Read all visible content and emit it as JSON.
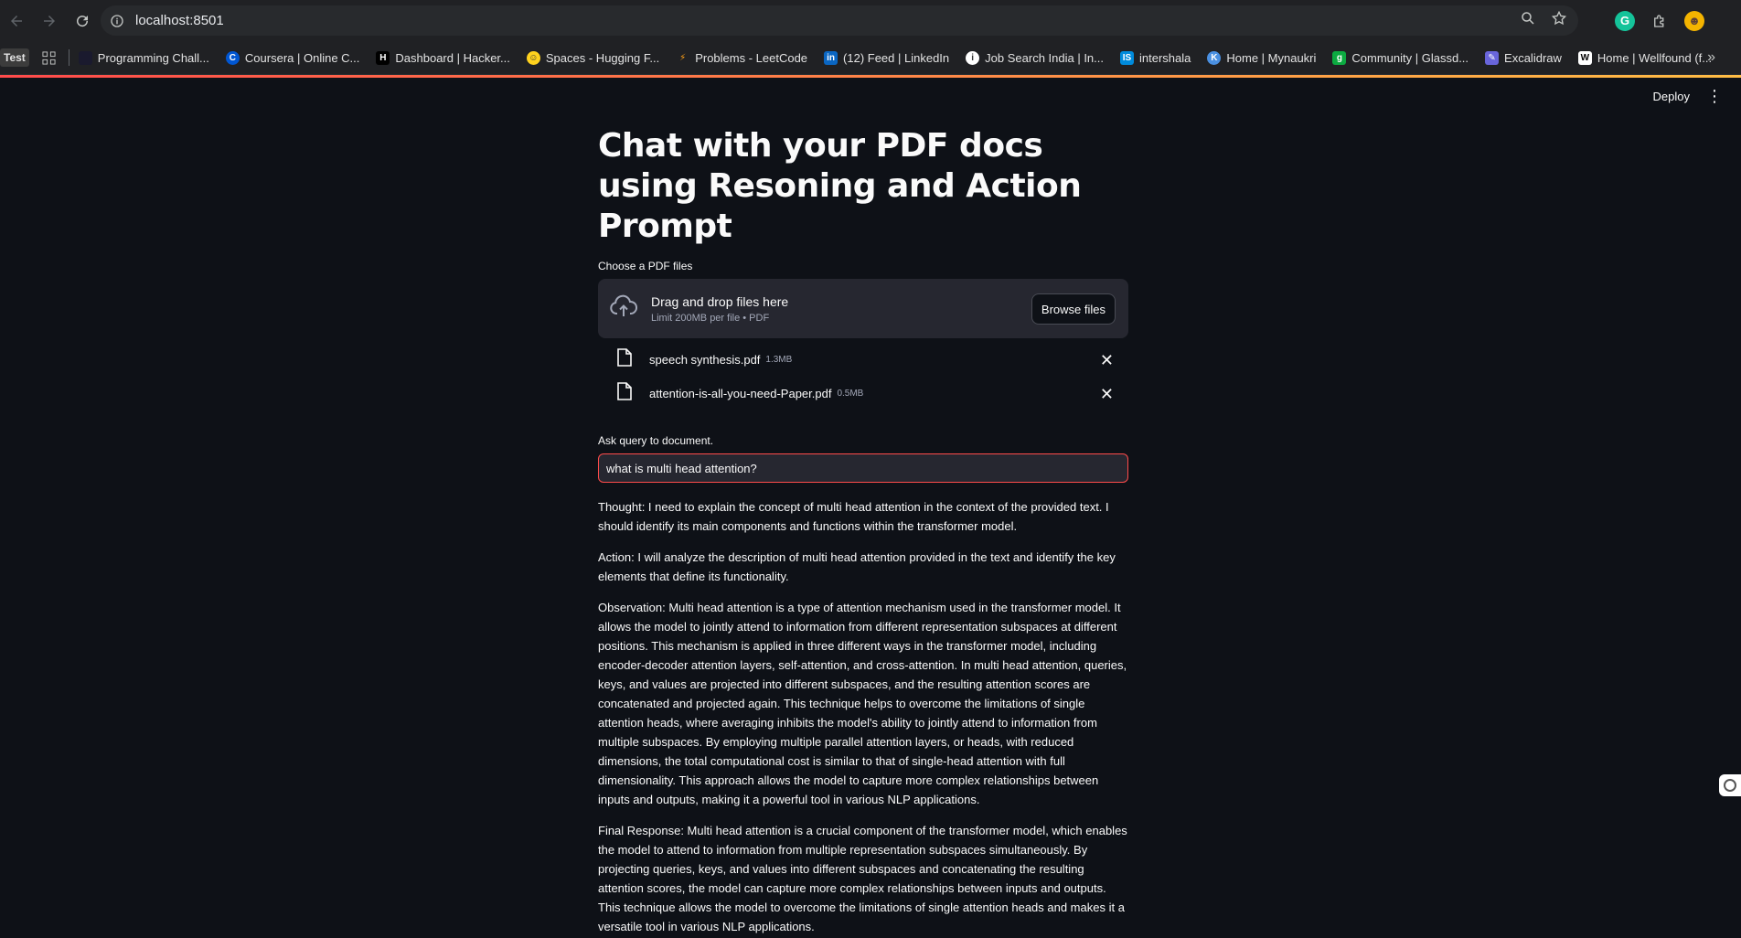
{
  "browser": {
    "url": "localhost:8501",
    "bookmarks": [
      {
        "label": "Test"
      },
      {
        "label": "Programming Chall...",
        "icon": "bookmark-favicon",
        "color": "#1a1a2e"
      },
      {
        "label": "Coursera | Online C...",
        "icon": "coursera-icon",
        "color": "#0056d2"
      },
      {
        "label": "Dashboard | Hacker...",
        "icon": "hackerrank-icon",
        "color": "#000000"
      },
      {
        "label": "Spaces - Hugging F...",
        "icon": "huggingface-icon",
        "color": "#ffd21e"
      },
      {
        "label": "Problems - LeetCode",
        "icon": "leetcode-icon",
        "color": "#ffa116"
      },
      {
        "label": "(12) Feed | LinkedIn",
        "icon": "linkedin-icon",
        "color": "#0a66c2"
      },
      {
        "label": "Job Search India | In...",
        "icon": "indeed-icon",
        "color": "#ffffff"
      },
      {
        "label": "intershala",
        "icon": "internshala-icon",
        "color": "#008bdc"
      },
      {
        "label": "Home | Mynaukri",
        "icon": "naukri-icon",
        "color": "#4a90e2"
      },
      {
        "label": "Community | Glassd...",
        "icon": "glassdoor-icon",
        "color": "#0caa41"
      },
      {
        "label": "Excalidraw",
        "icon": "excalidraw-icon",
        "color": "#6965db"
      },
      {
        "label": "Home | Wellfound (f...",
        "icon": "wellfound-icon",
        "color": "#ffffff"
      }
    ]
  },
  "app": {
    "deploy_label": "Deploy",
    "title": "Chat with your PDF docs using Resoning and Action Prompt",
    "uploader": {
      "label": "Choose a PDF files",
      "drop_text": "Drag and drop files here",
      "limit_text": "Limit 200MB per file • PDF",
      "browse_label": "Browse files"
    },
    "files": [
      {
        "name": "speech synthesis.pdf",
        "size": "1.3MB"
      },
      {
        "name": "attention-is-all-you-need-Paper.pdf",
        "size": "0.5MB"
      }
    ],
    "query": {
      "label": "Ask query to document.",
      "value": "what is multi head attention?"
    },
    "response": {
      "thought": "Thought: I need to explain the concept of multi head attention in the context of the provided text. I should identify its main components and functions within the transformer model.",
      "action": "Action: I will analyze the description of multi head attention provided in the text and identify the key elements that define its functionality.",
      "observation": "Observation: Multi head attention is a type of attention mechanism used in the transformer model. It allows the model to jointly attend to information from different representation subspaces at different positions. This mechanism is applied in three different ways in the transformer model, including encoder-decoder attention layers, self-attention, and cross-attention. In multi head attention, queries, keys, and values are projected into different subspaces, and the resulting attention scores are concatenated and projected again. This technique helps to overcome the limitations of single attention heads, where averaging inhibits the model's ability to jointly attend to information from multiple subspaces. By employing multiple parallel attention layers, or heads, with reduced dimensions, the total computational cost is similar to that of single-head attention with full dimensionality. This approach allows the model to capture more complex relationships between inputs and outputs, making it a powerful tool in various NLP applications.",
      "final": "Final Response: Multi head attention is a crucial component of the transformer model, which enables the model to attend to information from multiple representation subspaces simultaneously. By projecting queries, keys, and values into different subspaces and concatenating the resulting attention scores, the model can capture more complex relationships between inputs and outputs. This technique allows the model to overcome the limitations of single attention heads and makes it a versatile tool in various NLP applications."
    }
  },
  "colors": {
    "background": "#0e1117",
    "widget_bg": "#262730",
    "accent": "#ff4b4b"
  }
}
